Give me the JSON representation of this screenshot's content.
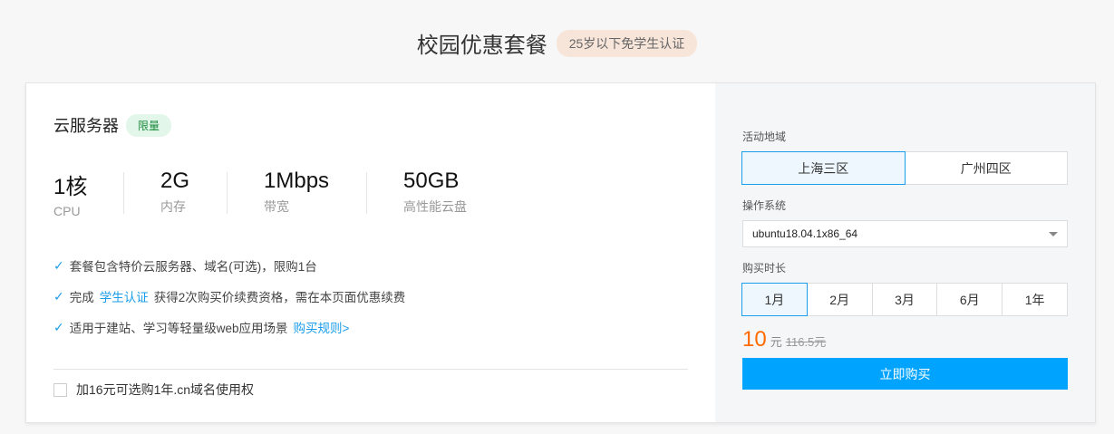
{
  "header": {
    "title": "校园优惠套餐",
    "badge": "25岁以下免学生认证"
  },
  "product": {
    "title": "云服务器",
    "tag": "限量",
    "specs": [
      {
        "value": "1核",
        "label": "CPU"
      },
      {
        "value": "2G",
        "label": "内存"
      },
      {
        "value": "1Mbps",
        "label": "带宽"
      },
      {
        "value": "50GB",
        "label": "高性能云盘"
      }
    ],
    "features": [
      {
        "text": "套餐包含特价云服务器、域名(可选)，限购1台"
      },
      {
        "pre": "完成",
        "link": "学生认证",
        "post": "获得2次购买价续费资格，需在本页面优惠续费"
      },
      {
        "text": "适用于建站、学习等轻量级web应用场景",
        "link": "购买规则>"
      }
    ],
    "addon": "加16元可选购1年.cn域名使用权"
  },
  "config": {
    "region_label": "活动地域",
    "regions": [
      "上海三区",
      "广州四区"
    ],
    "os_label": "操作系统",
    "os_value": "ubuntu18.04.1x86_64",
    "duration_label": "购买时长",
    "durations": [
      "1月",
      "2月",
      "3月",
      "6月",
      "1年"
    ],
    "price": "10",
    "unit": "元",
    "original_price": "116.5元",
    "buy": "立即购买"
  }
}
